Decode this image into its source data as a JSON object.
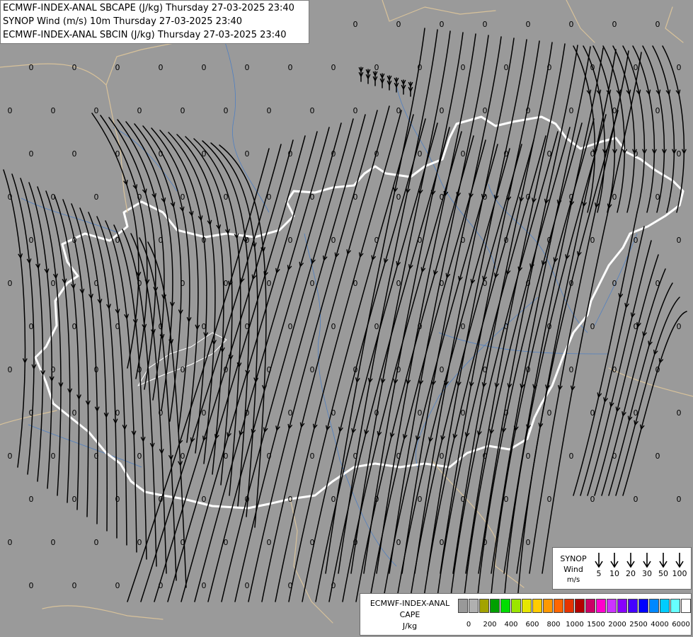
{
  "header": {
    "line1": "ECMWF-INDEX-ANAL SBCAPE (J/kg) Thursday 27-03-2025 23:40",
    "line2": "SYNOP Wind (m/s) 10m Thursday 27-03-2025 23:40",
    "line3": "ECMWF-INDEX-ANAL SBCIN (J/kg) Thursday 27-03-2025 23:40"
  },
  "map": {
    "value_label": "0",
    "colors": {
      "background": "#9a9a9a",
      "streamline": "#000000",
      "country_border": "#ffffff",
      "neighbour_border": "#d8c29a",
      "rivers": "#4f7fc1"
    }
  },
  "legend_wind": {
    "title_line1": "SYNOP",
    "title_line2": "Wind",
    "title_line3": "m/s",
    "speeds": [
      "5",
      "10",
      "20",
      "30",
      "50",
      "100"
    ]
  },
  "legend_cape": {
    "title_line1": "ECMWF-INDEX-ANAL",
    "title_line2": "CAPE",
    "title_line3": "J/kg",
    "colors": [
      "#999999",
      "#b0b0b0",
      "#a3a300",
      "#00a000",
      "#00dd00",
      "#9be600",
      "#e6e600",
      "#ffcc00",
      "#ff9900",
      "#ff6600",
      "#e63300",
      "#b30000",
      "#cc0066",
      "#ff00cc",
      "#cc33ff",
      "#8800ff",
      "#4400ff",
      "#0000ff",
      "#0088ff",
      "#00ccff",
      "#66ffff",
      "#ffffff"
    ],
    "tick_labels": [
      "0",
      "200",
      "400",
      "600",
      "800",
      "1000",
      "1500",
      "2000",
      "2500",
      "4000",
      "6000"
    ]
  }
}
